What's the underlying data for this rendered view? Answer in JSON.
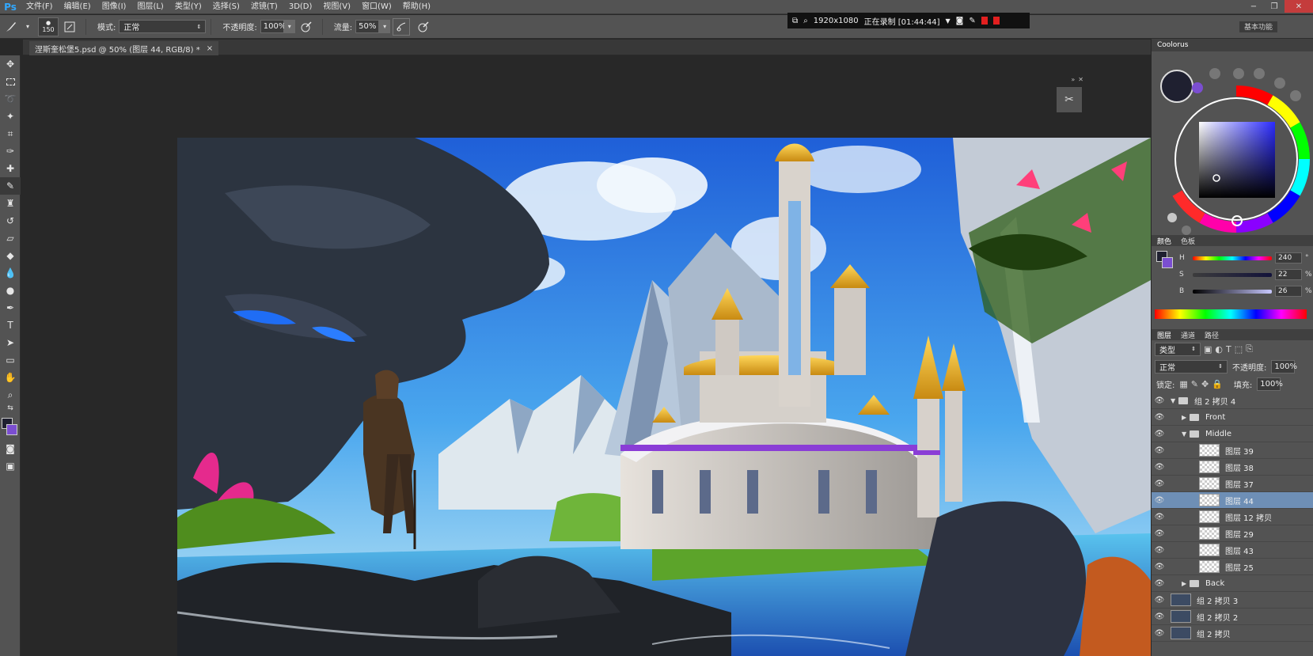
{
  "menu": {
    "logo": "Ps",
    "items": [
      "文件(F)",
      "编辑(E)",
      "图像(I)",
      "图层(L)",
      "类型(Y)",
      "选择(S)",
      "滤镜(T)",
      "3D(D)",
      "视图(V)",
      "窗口(W)",
      "帮助(H)"
    ]
  },
  "window_controls": {
    "minimize": "−",
    "restore": "❐",
    "close": "✕"
  },
  "options": {
    "brush_size": "150",
    "mode_label": "模式:",
    "mode_value": "正常",
    "opacity_label": "不透明度:",
    "opacity_value": "100%",
    "flow_label": "流量:",
    "flow_value": "50%"
  },
  "recording": {
    "resolution": "1920x1080",
    "status": "正在录制 [01:44:44]"
  },
  "workspace": {
    "label": "基本功能"
  },
  "document_tab": {
    "title": "涅斯奎松堡5.psd @ 50% (图层 44, RGB/8) *",
    "close": "×"
  },
  "colorus_panel": {
    "title": "Coolorus"
  },
  "color_panel": {
    "tabs": [
      "颜色",
      "色板"
    ],
    "h": {
      "label": "H",
      "value": "240",
      "unit": "°"
    },
    "s": {
      "label": "S",
      "value": "22",
      "unit": "%"
    },
    "b": {
      "label": "B",
      "value": "26",
      "unit": "%"
    }
  },
  "layers_panel": {
    "tabs": [
      "图层",
      "通道",
      "路径"
    ],
    "filter": "类型",
    "blend_mode": "正常",
    "opacity_label": "不透明度:",
    "opacity_value": "100%",
    "lock_label": "锁定:",
    "fill_label": "填充:",
    "fill_value": "100%",
    "layers": [
      {
        "name": "组 2 拷贝 4",
        "kind": "group",
        "depth": 0,
        "open": true
      },
      {
        "name": "Front",
        "kind": "group",
        "depth": 1,
        "open": false
      },
      {
        "name": "Middle",
        "kind": "group",
        "depth": 1,
        "open": true
      },
      {
        "name": "图层 39",
        "kind": "layer",
        "depth": 2
      },
      {
        "name": "图层 38",
        "kind": "layer",
        "depth": 2
      },
      {
        "name": "图层 37",
        "kind": "layer",
        "depth": 2
      },
      {
        "name": "图层 44",
        "kind": "layer",
        "depth": 2,
        "selected": true
      },
      {
        "name": "图层 12 拷贝",
        "kind": "layer",
        "depth": 2
      },
      {
        "name": "图层 29",
        "kind": "layer",
        "depth": 2
      },
      {
        "name": "图层 43",
        "kind": "layer",
        "depth": 2
      },
      {
        "name": "图层 25",
        "kind": "layer",
        "depth": 2
      },
      {
        "name": "Back",
        "kind": "group",
        "depth": 1,
        "open": false
      },
      {
        "name": "组 2 拷贝 3",
        "kind": "image",
        "depth": 0
      },
      {
        "name": "组 2 拷贝 2",
        "kind": "image",
        "depth": 0
      },
      {
        "name": "组 2 拷贝",
        "kind": "image",
        "depth": 0
      }
    ]
  },
  "colors": {
    "foreground": "#1f2030",
    "background": "#7b4ed1",
    "selection": "#6e8fb6"
  }
}
